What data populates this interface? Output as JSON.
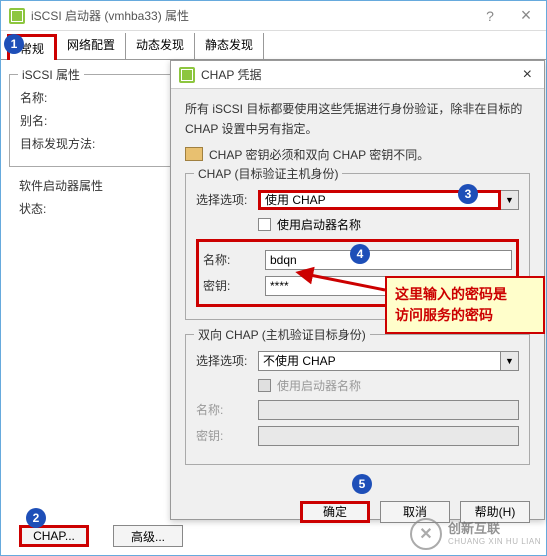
{
  "main_window": {
    "title": "iSCSI 启动器 (vmhba33) 属性",
    "tabs": [
      "常规",
      "网络配置",
      "动态发现",
      "静态发现"
    ],
    "active_tab_index": 0
  },
  "iscsi_group": {
    "legend": "iSCSI 属性",
    "name_label": "名称:",
    "alias_label": "别名:",
    "discovery_label": "目标发现方法:"
  },
  "software_group": {
    "legend": "软件启动器属性",
    "status_label": "状态:"
  },
  "dialog": {
    "title": "CHAP 凭据",
    "instruction": "所有 iSCSI 目标都要使用这些凭据进行身份验证，除非在目标的 CHAP 设置中另有指定。",
    "instruction2": "CHAP 密钥必须和双向 CHAP 密钥不同。"
  },
  "chap_section": {
    "legend": "CHAP (目标验证主机身份)",
    "select_label": "选择选项:",
    "select_value": "使用 CHAP",
    "use_initiator_label": "使用启动器名称",
    "name_label": "名称:",
    "name_value": "bdqn",
    "key_label": "密钥:",
    "key_value": "****"
  },
  "mutual_section": {
    "legend": "双向 CHAP (主机验证目标身份)",
    "select_label": "选择选项:",
    "select_value": "不使用 CHAP",
    "use_initiator_label": "使用启动器名称",
    "name_label": "名称:",
    "key_label": "密钥:"
  },
  "buttons": {
    "ok": "确定",
    "cancel": "取消",
    "help": "帮助(H)",
    "chap": "CHAP...",
    "advanced": "高级..."
  },
  "callout": {
    "line1": "这里输入的密码是",
    "line2": "访问服务的密码"
  },
  "watermark": {
    "brand": "创新互联",
    "sub": "CHUANG XIN HU LIAN"
  }
}
